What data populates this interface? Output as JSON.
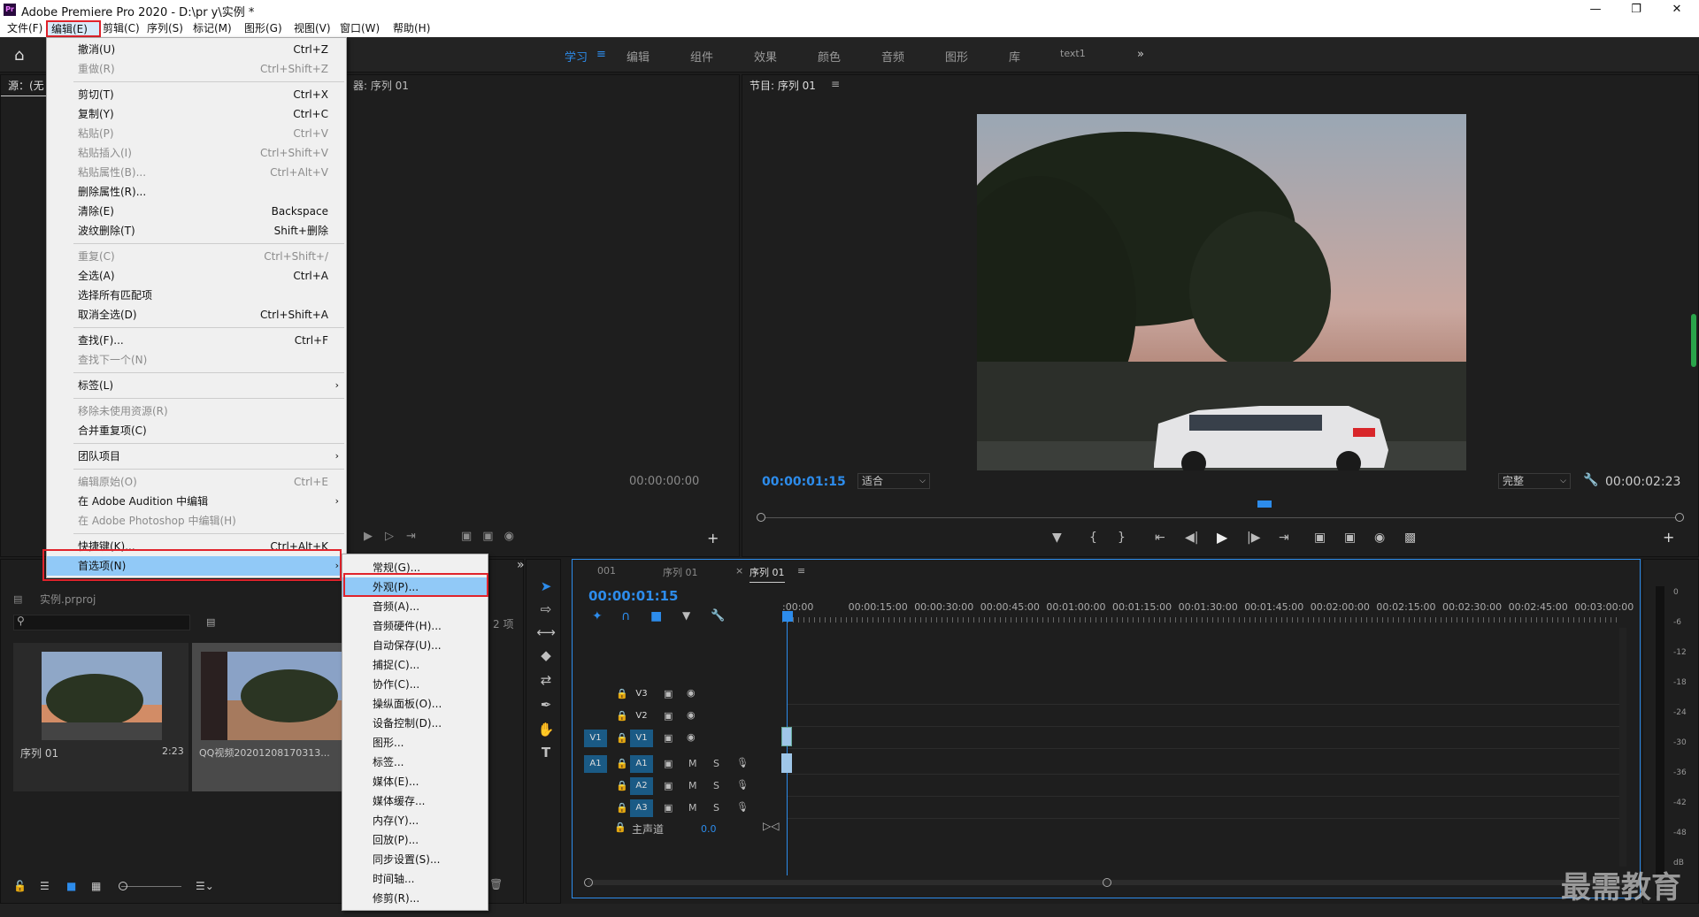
{
  "titlebar": {
    "title": "Adobe Premiere Pro 2020 - D:\\pr y\\实例 *",
    "appicon": "Pr"
  },
  "menubar": {
    "items": [
      "文件(F)",
      "编辑(E)",
      "剪辑(C)",
      "序列(S)",
      "标记(M)",
      "图形(G)",
      "视图(V)",
      "窗口(W)",
      "帮助(H)"
    ]
  },
  "workspace": {
    "tabs": [
      "学习",
      "编辑",
      "组件",
      "效果",
      "颜色",
      "音频",
      "图形",
      "库",
      "text1"
    ],
    "active": "学习"
  },
  "source": {
    "tab": "源：(无",
    "effects_tab": "器: 序列 01",
    "timecode": "00:00:00:00"
  },
  "program": {
    "title": "节目: 序列 01",
    "timecode": "00:00:01:15",
    "fit": "适合",
    "quality": "完整",
    "duration": "00:00:02:23"
  },
  "edit_menu": [
    {
      "label": "撤消(U)",
      "shortcut": "Ctrl+Z",
      "disabled": false
    },
    {
      "label": "重做(R)",
      "shortcut": "Ctrl+Shift+Z",
      "disabled": true
    },
    {
      "sep": true
    },
    {
      "label": "剪切(T)",
      "shortcut": "Ctrl+X",
      "disabled": false
    },
    {
      "label": "复制(Y)",
      "shortcut": "Ctrl+C",
      "disabled": false
    },
    {
      "label": "粘贴(P)",
      "shortcut": "Ctrl+V",
      "disabled": true
    },
    {
      "label": "粘贴插入(I)",
      "shortcut": "Ctrl+Shift+V",
      "disabled": true
    },
    {
      "label": "粘贴属性(B)...",
      "shortcut": "Ctrl+Alt+V",
      "disabled": true
    },
    {
      "label": "删除属性(R)...",
      "shortcut": "",
      "disabled": false
    },
    {
      "label": "清除(E)",
      "shortcut": "Backspace",
      "disabled": false
    },
    {
      "label": "波纹删除(T)",
      "shortcut": "Shift+删除",
      "disabled": false
    },
    {
      "sep": true
    },
    {
      "label": "重复(C)",
      "shortcut": "Ctrl+Shift+/",
      "disabled": true
    },
    {
      "label": "全选(A)",
      "shortcut": "Ctrl+A",
      "disabled": false
    },
    {
      "label": "选择所有匹配项",
      "shortcut": "",
      "disabled": false
    },
    {
      "label": "取消全选(D)",
      "shortcut": "Ctrl+Shift+A",
      "disabled": false
    },
    {
      "sep": true
    },
    {
      "label": "查找(F)...",
      "shortcut": "Ctrl+F",
      "disabled": false
    },
    {
      "label": "查找下一个(N)",
      "shortcut": "",
      "disabled": true
    },
    {
      "sep": true
    },
    {
      "label": "标签(L)",
      "shortcut": "",
      "disabled": false,
      "sub": true
    },
    {
      "sep": true
    },
    {
      "label": "移除未使用资源(R)",
      "shortcut": "",
      "disabled": true
    },
    {
      "label": "合并重复项(C)",
      "shortcut": "",
      "disabled": false
    },
    {
      "sep": true
    },
    {
      "label": "团队项目",
      "shortcut": "",
      "disabled": false,
      "sub": true
    },
    {
      "sep": true
    },
    {
      "label": "编辑原始(O)",
      "shortcut": "Ctrl+E",
      "disabled": true
    },
    {
      "label": "在 Adobe Audition 中编辑",
      "shortcut": "",
      "disabled": false,
      "sub": true
    },
    {
      "label": "在 Adobe Photoshop 中编辑(H)",
      "shortcut": "",
      "disabled": true
    },
    {
      "sep": true
    },
    {
      "label": "快捷键(K)...",
      "shortcut": "Ctrl+Alt+K",
      "disabled": false
    },
    {
      "label": "首选项(N)",
      "shortcut": "",
      "disabled": false,
      "sub": true,
      "highlight": true
    }
  ],
  "prefs_menu": [
    "常规(G)...",
    "外观(P)...",
    "音频(A)...",
    "音频硬件(H)...",
    "自动保存(U)...",
    "捕捉(C)...",
    "协作(C)...",
    "操纵面板(O)...",
    "设备控制(D)...",
    "图形...",
    "标签...",
    "媒体(E)...",
    "媒体缓存...",
    "内存(Y)...",
    "回放(P)...",
    "同步设置(S)...",
    "时间轴...",
    "修剪(R)..."
  ],
  "project": {
    "name": "实例.prproj",
    "count": "2 项",
    "items": [
      {
        "name": "序列 01",
        "duration": "2:23"
      },
      {
        "name": "QQ视频20201208170313...",
        "duration": ""
      }
    ]
  },
  "timeline": {
    "tabs": [
      "001",
      "序列 01",
      "序列 01"
    ],
    "timecode": "00:00:01:15",
    "ruler": [
      ":00:00",
      "00:00:15:00",
      "00:00:30:00",
      "00:00:45:00",
      "00:01:00:00",
      "00:01:15:00",
      "00:01:30:00",
      "00:01:45:00",
      "00:02:00:00",
      "00:02:15:00",
      "00:02:30:00",
      "00:02:45:00",
      "00:03:00:00"
    ],
    "video_tracks": [
      "V3",
      "V2",
      "V1"
    ],
    "audio_tracks": [
      "A1",
      "A2",
      "A3"
    ],
    "master": "主声道",
    "master_val": "0.0",
    "src_v": "V1",
    "src_a": "A1"
  },
  "meter": {
    "labels": [
      "0",
      "-6",
      "-12",
      "-18",
      "-24",
      "-30",
      "-36",
      "-42",
      "-48",
      "dB"
    ]
  },
  "watermark": "最需教育",
  "colors": {
    "accent": "#2d8ceb",
    "highlight": "#91c9f7",
    "red": "#e0232b"
  }
}
